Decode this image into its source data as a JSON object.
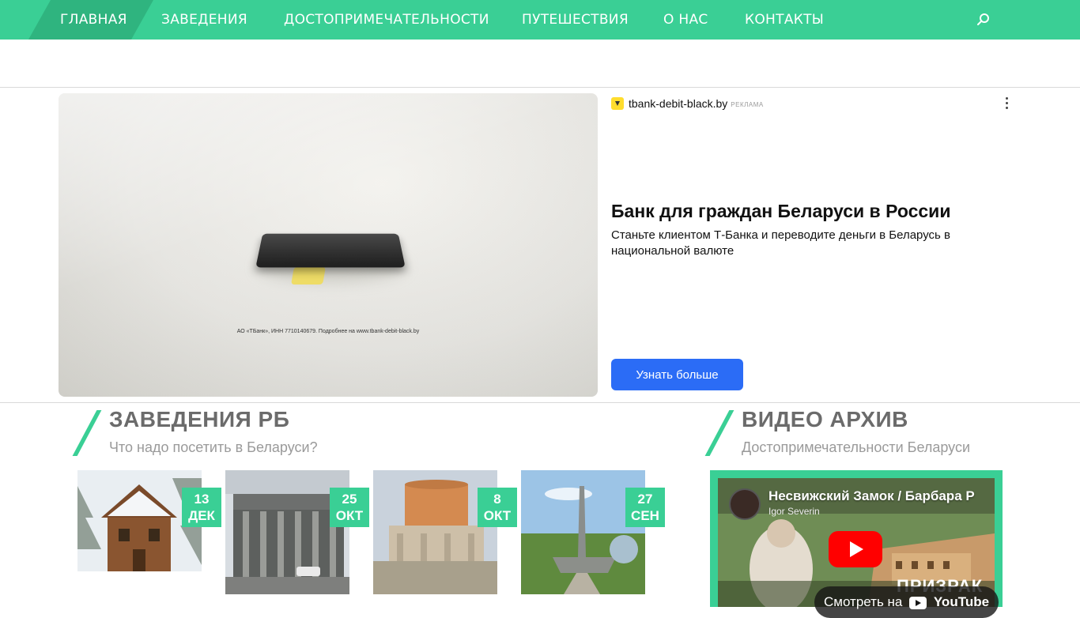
{
  "nav": {
    "items": [
      {
        "label": "ГЛАВНАЯ",
        "active": true
      },
      {
        "label": "ЗАВЕДЕНИЯ"
      },
      {
        "label": "ДОСТОПРИМЕЧАТЕЛЬНОСТИ"
      },
      {
        "label": "ПУТЕШЕСТВИЯ"
      },
      {
        "label": "О НАС"
      },
      {
        "label": "КОНТАКТЫ"
      }
    ],
    "search_icon": "search-icon"
  },
  "colors": {
    "accent": "#3acf95",
    "accent_dark": "#2fb47f",
    "ad_button": "#2b6cf6"
  },
  "ad": {
    "domain": "tbank-debit-black.by",
    "tag": "РЕКЛАМА",
    "title": "Банк для граждан Беларуси в России",
    "description": "Станьте клиентом Т-Банка и переводите деньги в Беларусь в национальной валюте",
    "cta": "Узнать больше",
    "image_legal": "АО «ТБанк», ИНН 7710140679. Подробнее на www.tbank-debit-black.by"
  },
  "places": {
    "title": "ЗАВЕДЕНИЯ РБ",
    "subtitle": "Что надо посетить в Беларуси?",
    "cards": [
      {
        "day": "13",
        "month": "ДЕК"
      },
      {
        "day": "25",
        "month": "ОКТ"
      },
      {
        "day": "8",
        "month": "ОКТ"
      },
      {
        "day": "27",
        "month": "СЕН"
      }
    ]
  },
  "video": {
    "title": "ВИДЕО АРХИВ",
    "subtitle": "Достопримечательности Беларуси",
    "player": {
      "video_title": "Несвижский Замок / Барбара Р",
      "author": "Igor Severin",
      "watch_on": "Смотреть на",
      "platform": "YouTube",
      "overlay_text": "ПРИЗРАК"
    }
  }
}
